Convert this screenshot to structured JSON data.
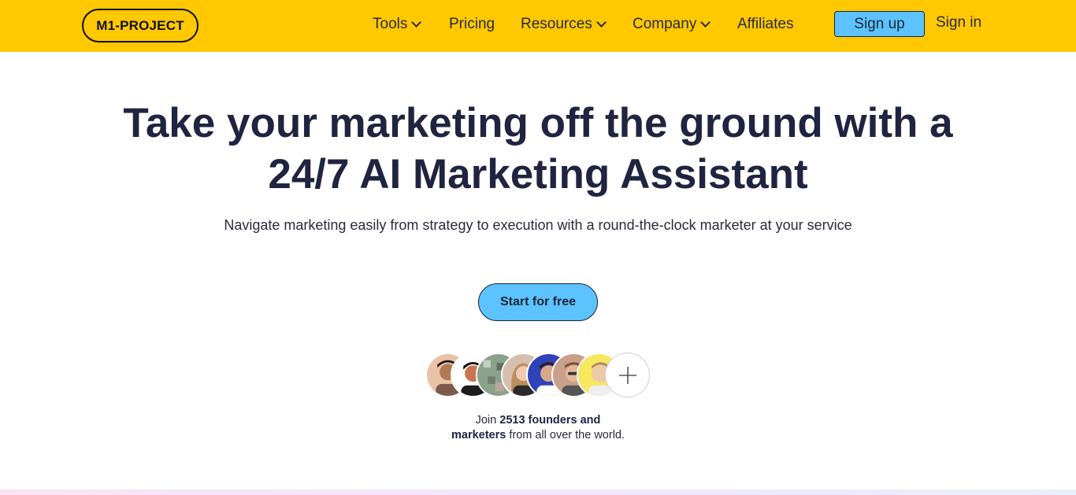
{
  "header": {
    "logo": "M1-PROJECT",
    "nav": [
      {
        "label": "Tools",
        "dropdown": true
      },
      {
        "label": "Pricing",
        "dropdown": false
      },
      {
        "label": "Resources",
        "dropdown": true
      },
      {
        "label": "Company",
        "dropdown": true
      },
      {
        "label": "Affiliates",
        "dropdown": false
      }
    ],
    "signup_label": "Sign up",
    "signin_label": "Sign in"
  },
  "hero": {
    "title_line1": "Take your marketing off the ground with a",
    "title_line2": "24/7 AI Marketing Assistant",
    "subtitle": "Navigate marketing easily from strategy to execution with a round-the-clock marketer at your service",
    "cta_label": "Start for free"
  },
  "social_proof": {
    "avatar_count": 7,
    "plus_icon": "plus-icon",
    "join_prefix": "Join",
    "join_bold_1": "2513 founders and",
    "join_bold_2": "marketers",
    "join_suffix": "from all over the world."
  },
  "colors": {
    "header_bg": "#ffc800",
    "accent_blue": "#5cc3ff",
    "title_text": "#1f2440"
  }
}
